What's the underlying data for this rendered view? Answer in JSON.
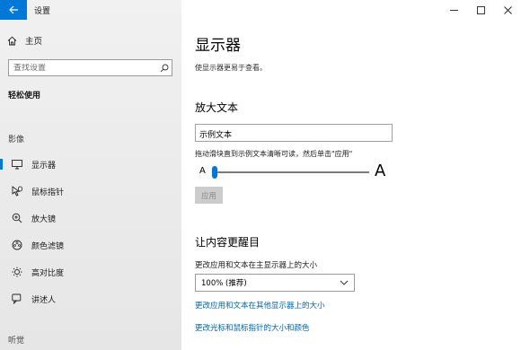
{
  "window": {
    "title": "设置"
  },
  "sidebar": {
    "home_label": "主页",
    "search_placeholder": "查找设置",
    "section_title": "轻松使用",
    "group_vision": "影像",
    "items": [
      {
        "label": "显示器",
        "icon": "monitor-icon",
        "active": true
      },
      {
        "label": "鼠标指针",
        "icon": "mouse-pointer-icon",
        "active": false
      },
      {
        "label": "放大镜",
        "icon": "magnifier-icon",
        "active": false
      },
      {
        "label": "颜色滤镜",
        "icon": "color-filter-icon",
        "active": false
      },
      {
        "label": "高对比度",
        "icon": "high-contrast-icon",
        "active": false
      },
      {
        "label": "讲述人",
        "icon": "narrator-icon",
        "active": false
      }
    ],
    "group_hearing": "听觉"
  },
  "main": {
    "title": "显示器",
    "description": "使显示器更易于查看。",
    "enlarge_text": {
      "heading": "放大文本",
      "sample_text": "示例文本",
      "hint": "拖动滑块直到示例文本清晰可读，然后单击\"应用\"",
      "slider_min_label": "A",
      "slider_max_label": "A",
      "slider_value": 0,
      "apply_label": "应用"
    },
    "brighter": {
      "heading": "让内容更醒目",
      "scale_label": "更改应用和文本在主显示器上的大小",
      "scale_value": "100% (推荐)",
      "link_other_displays": "更改应用和文本在其他显示器上的大小",
      "link_pointer": "更改光标和鼠标指针的大小和颜色"
    }
  },
  "colors": {
    "accent": "#0078d7",
    "link": "#0063b1"
  }
}
